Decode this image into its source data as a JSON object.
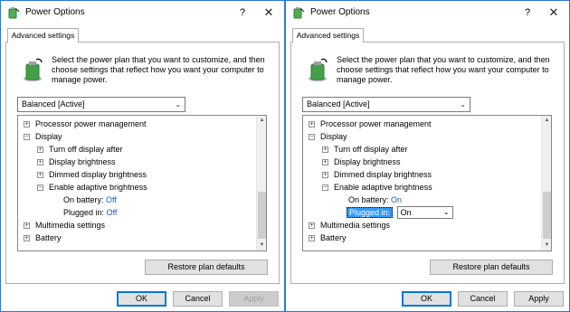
{
  "windows": [
    {
      "title": "Power Options",
      "tab": "Advanced settings",
      "intro": "Select the power plan that you want to customize, and then choose settings that reflect how you want your computer to manage power.",
      "plan": "Balanced [Active]",
      "tree": {
        "processor": "Processor power management",
        "display": "Display",
        "turn_off": "Turn off display after",
        "brightness": "Display brightness",
        "dimmed": "Dimmed display brightness",
        "adaptive": "Enable adaptive brightness",
        "on_battery_label": "On battery:",
        "on_battery_value": "Off",
        "plugged_in_label": "Plugged in:",
        "plugged_in_value": "Off",
        "multimedia": "Multimedia settings",
        "battery": "Battery"
      },
      "restore": "Restore plan defaults",
      "ok": "OK",
      "cancel": "Cancel",
      "apply": "Apply",
      "help_glyph": "?",
      "close_glyph": "✕",
      "chevron_glyph": "⌄"
    },
    {
      "title": "Power Options",
      "tab": "Advanced settings",
      "intro": "Select the power plan that you want to customize, and then choose settings that reflect how you want your computer to manage power.",
      "plan": "Balanced [Active]",
      "tree": {
        "processor": "Processor power management",
        "display": "Display",
        "turn_off": "Turn off display after",
        "brightness": "Display brightness",
        "dimmed": "Dimmed display brightness",
        "adaptive": "Enable adaptive brightness",
        "on_battery_label": "On battery:",
        "on_battery_value": "On",
        "plugged_in_label": "Plugged in:",
        "plugged_in_value": "On",
        "multimedia": "Multimedia settings",
        "battery": "Battery"
      },
      "restore": "Restore plan defaults",
      "ok": "OK",
      "cancel": "Cancel",
      "apply": "Apply",
      "help_glyph": "?",
      "close_glyph": "✕",
      "chevron_glyph": "⌄"
    }
  ],
  "colors": {
    "accent": "#0078d7",
    "selection": "#3399ff",
    "value_link": "#1a5fb4",
    "window_border": "#2b79d8"
  }
}
